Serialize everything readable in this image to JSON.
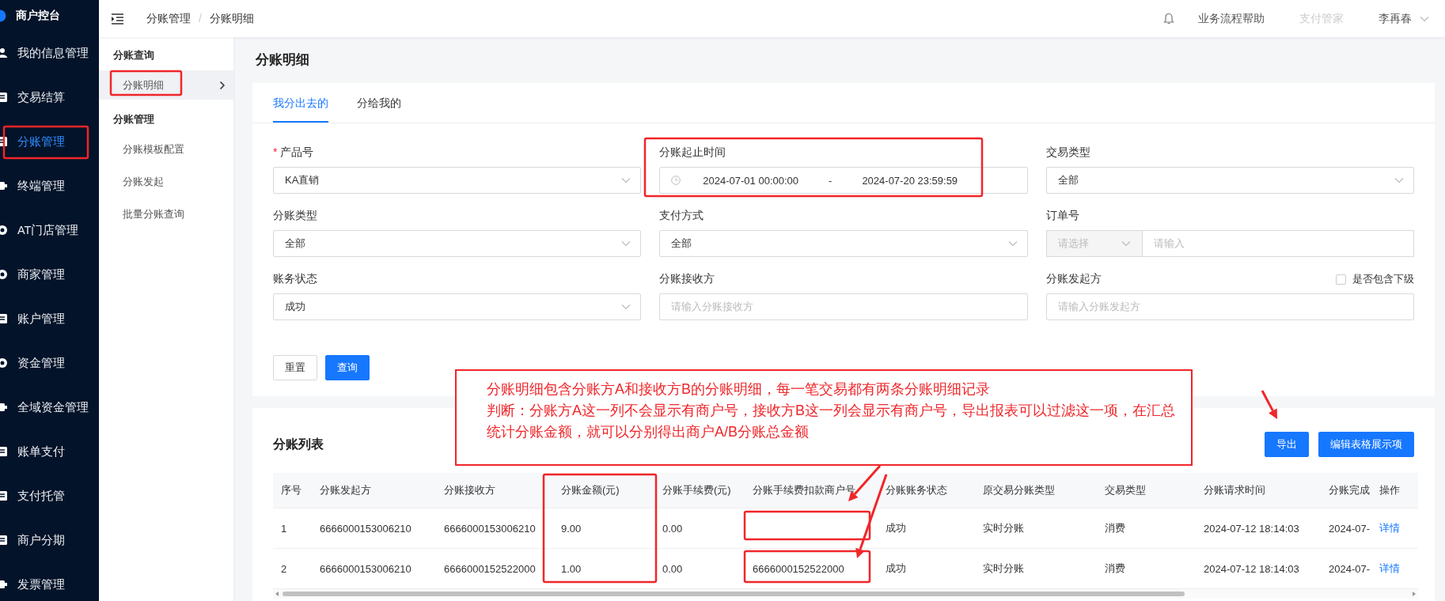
{
  "sidebar": {
    "brand": "商户控台",
    "items": [
      {
        "label": "我的信息管理",
        "kind": "person",
        "selected": false
      },
      {
        "label": "交易结算",
        "kind": "doc",
        "selected": false
      },
      {
        "label": "分账管理",
        "kind": "doc",
        "selected": true
      },
      {
        "label": "终端管理",
        "kind": "device",
        "selected": false
      },
      {
        "label": "AT门店管理",
        "kind": "coin",
        "selected": false
      },
      {
        "label": "商家管理",
        "kind": "coin",
        "selected": false
      },
      {
        "label": "账户管理",
        "kind": "doc",
        "selected": false
      },
      {
        "label": "资金管理",
        "kind": "coin",
        "selected": false
      },
      {
        "label": "全域资金管理",
        "kind": "device",
        "selected": false
      },
      {
        "label": "账单支付",
        "kind": "doc",
        "selected": false
      },
      {
        "label": "支付托管",
        "kind": "doc",
        "selected": false
      },
      {
        "label": "商户分期",
        "kind": "doc",
        "selected": false
      },
      {
        "label": "发票管理",
        "kind": "device",
        "selected": false
      }
    ]
  },
  "header": {
    "breadcrumb": [
      "分账管理",
      "分账明细"
    ],
    "separator": "/",
    "links": [
      {
        "label": "业务流程帮助",
        "disabled": false
      },
      {
        "label": "支付管家",
        "disabled": true
      }
    ],
    "user": "李再春"
  },
  "submenu": {
    "groups": [
      {
        "title": "分账查询",
        "items": [
          {
            "label": "分账明细",
            "selected": true
          }
        ]
      },
      {
        "title": "分账管理",
        "items": [
          {
            "label": "分账模板配置",
            "selected": false
          },
          {
            "label": "分账发起",
            "selected": false
          },
          {
            "label": "批量分账查询",
            "selected": false
          }
        ]
      }
    ]
  },
  "page_title": "分账明细",
  "tabs": [
    {
      "label": "我分出去的",
      "selected": true
    },
    {
      "label": "分给我的",
      "selected": false
    }
  ],
  "required_mark": "*",
  "filters": [
    {
      "label": "产品号",
      "required": true,
      "kind": "select",
      "value": "KA直销"
    },
    {
      "label": "分账起止时间",
      "required": false,
      "kind": "daterange",
      "start": "2024-07-01 00:00:00",
      "separator": "-",
      "end": "2024-07-20 23:59:59"
    },
    {
      "label": "交易类型",
      "required": false,
      "kind": "select",
      "value": "全部"
    },
    {
      "label": "分账类型",
      "required": false,
      "kind": "select",
      "value": "全部"
    },
    {
      "label": "支付方式",
      "required": false,
      "kind": "select",
      "value": "全部"
    },
    {
      "label": "订单号",
      "required": false,
      "kind": "combo",
      "select_placeholder": "请选择",
      "placeholder": "请输入"
    },
    {
      "label": "账务状态",
      "required": false,
      "kind": "select",
      "value": "成功"
    },
    {
      "label": "分账接收方",
      "required": false,
      "kind": "input",
      "placeholder": "请输入分账接收方"
    },
    {
      "label": "分账发起方",
      "required": false,
      "kind": "input",
      "placeholder": "请输入分账发起方",
      "checkbox": {
        "label": "是否包含下级",
        "checked": false
      }
    }
  ],
  "buttons": [
    {
      "label": "重置",
      "kind": "default"
    },
    {
      "label": "查询",
      "kind": "primary"
    }
  ],
  "table": {
    "title": "分账列表",
    "buttons": [
      {
        "label": "导出",
        "kind": "primary"
      },
      {
        "label": "编辑表格展示项",
        "kind": "primary"
      }
    ],
    "columns": [
      "序号",
      "分账发起方",
      "分账接收方",
      "分账金额(元)",
      "分账手续费(元)",
      "分账手续费扣款商户号",
      "分账账务状态",
      "原交易分账类型",
      "交易类型",
      "分账请求时间",
      "分账完成",
      "操作"
    ],
    "rows": [
      {
        "cells": [
          "1",
          "6666000153006210",
          "6666000153006210",
          "9.00",
          "0.00",
          null,
          "成功",
          "实时分账",
          "消费",
          "2024-07-12 18:14:03",
          "2024-07-"
        ],
        "action": "详情"
      },
      {
        "cells": [
          "2",
          "6666000153006210",
          "6666000152522000",
          "1.00",
          "0.00",
          "6666000152522000",
          "成功",
          "实时分账",
          "消费",
          "2024-07-12 18:14:03",
          "2024-07-"
        ],
        "action": "详情"
      }
    ]
  },
  "annotation": {
    "lines": [
      "分账明细包含分账方A和接收方B的分账明细，每一笔交易都有两条分账明细记录",
      "判断：分账方A这一列不会显示有商户号，接收方B这一列会显示有商户号，导出报表可以过滤这一项，在汇总统计分账金额，就可以分别得出商户A/B分账总金额"
    ]
  }
}
